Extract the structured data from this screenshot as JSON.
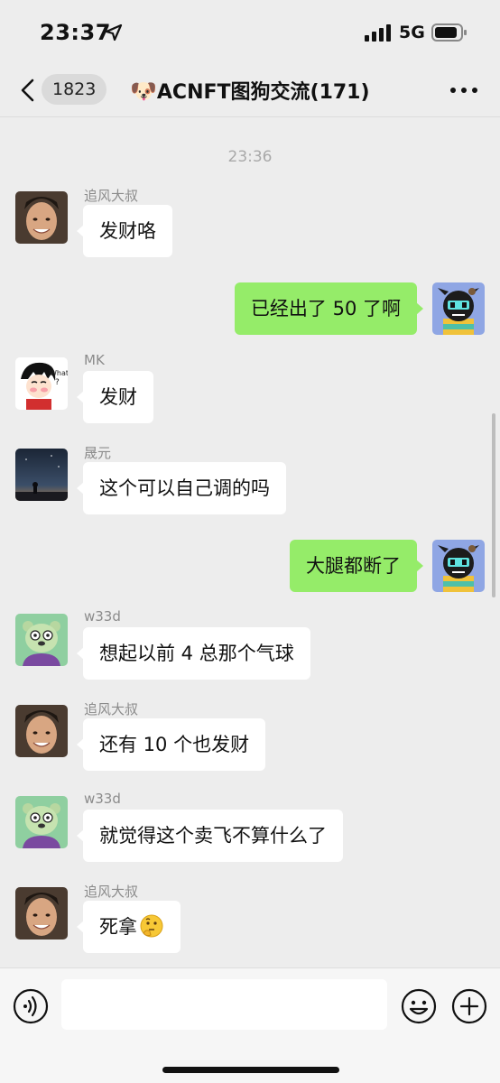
{
  "status_bar": {
    "time": "23:37",
    "network": "5G"
  },
  "header": {
    "unread_count": "1823",
    "title_emoji": "🐶",
    "title": "ACNFT图狗交流(171)"
  },
  "timestamp": "23:36",
  "messages": [
    {
      "direction": "in",
      "sender": "追风大叔",
      "text": "发财咯",
      "avatar": "avatar-photo-man"
    },
    {
      "direction": "out",
      "text": "已经出了 50 了啊",
      "avatar": "avatar-nft-dog"
    },
    {
      "direction": "in",
      "sender": "MK",
      "text": "发财",
      "avatar": "avatar-cartoon-luffy"
    },
    {
      "direction": "in",
      "sender": "晟元",
      "text": "这个可以自己调的吗",
      "avatar": "avatar-night-sky"
    },
    {
      "direction": "out",
      "text": "大腿都断了",
      "avatar": "avatar-nft-dog"
    },
    {
      "direction": "in",
      "sender": "w33d",
      "text": "想起以前 4 总那个气球",
      "avatar": "avatar-green-bear"
    },
    {
      "direction": "in",
      "sender": "追风大叔",
      "text": "还有 10 个也发财",
      "avatar": "avatar-photo-man"
    },
    {
      "direction": "in",
      "sender": "w33d",
      "text": "就觉得这个卖飞不算什么了",
      "avatar": "avatar-green-bear"
    },
    {
      "direction": "in",
      "sender": "追风大叔",
      "text": "死拿",
      "emoji": "thinking-face",
      "avatar": "avatar-photo-man"
    }
  ],
  "input": {
    "value": "",
    "placeholder": ""
  },
  "colors": {
    "background": "#ededed",
    "bubble_out": "#95ec69",
    "bubble_in": "#ffffff"
  }
}
